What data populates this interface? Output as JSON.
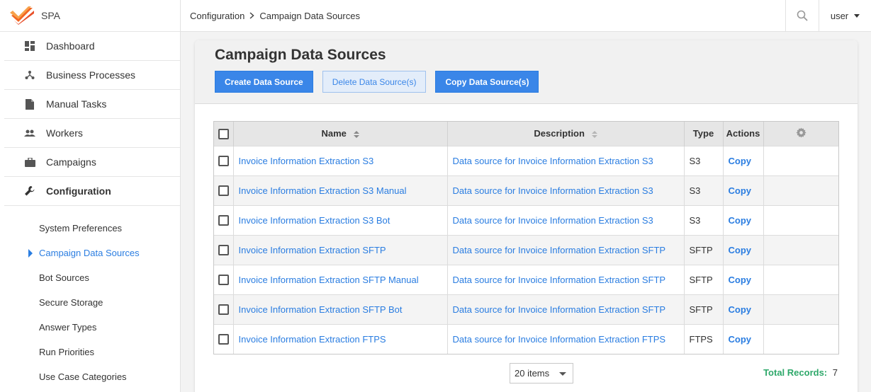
{
  "brand": {
    "name": "SPA",
    "accent": "#f26522"
  },
  "nav": {
    "items": [
      {
        "label": "Dashboard",
        "icon": "dashboard-icon"
      },
      {
        "label": "Business Processes",
        "icon": "process-icon"
      },
      {
        "label": "Manual Tasks",
        "icon": "document-icon"
      },
      {
        "label": "Workers",
        "icon": "workers-icon"
      },
      {
        "label": "Campaigns",
        "icon": "briefcase-icon"
      },
      {
        "label": "Configuration",
        "icon": "wrench-icon"
      }
    ],
    "sub_items": [
      "System Preferences",
      "Campaign Data Sources",
      "Bot Sources",
      "Secure Storage",
      "Answer Types",
      "Run Priorities",
      "Use Case Categories"
    ]
  },
  "topbar": {
    "breadcrumb": [
      "Configuration",
      "Campaign Data Sources"
    ],
    "user": "user"
  },
  "page": {
    "title": "Campaign Data Sources",
    "buttons": {
      "create": "Create Data Source",
      "delete": "Delete Data Source(s)",
      "copy": "Copy Data Source(s)"
    }
  },
  "table": {
    "columns": [
      "Name",
      "Description",
      "Type",
      "Actions"
    ],
    "rows": [
      {
        "name": "Invoice Information Extraction S3",
        "description": "Data source for Invoice Information Extraction S3",
        "type": "S3",
        "action": "Copy"
      },
      {
        "name": "Invoice Information Extraction S3 Manual",
        "description": "Data source for Invoice Information Extraction S3",
        "type": "S3",
        "action": "Copy"
      },
      {
        "name": "Invoice Information Extraction S3 Bot",
        "description": "Data source for Invoice Information Extraction S3",
        "type": "S3",
        "action": "Copy"
      },
      {
        "name": "Invoice Information Extraction SFTP",
        "description": "Data source for Invoice Information Extraction SFTP",
        "type": "SFTP",
        "action": "Copy"
      },
      {
        "name": "Invoice Information Extraction SFTP Manual",
        "description": "Data source for Invoice Information Extraction SFTP",
        "type": "SFTP",
        "action": "Copy"
      },
      {
        "name": "Invoice Information Extraction SFTP Bot",
        "description": "Data source for Invoice Information Extraction SFTP",
        "type": "SFTP",
        "action": "Copy"
      },
      {
        "name": "Invoice Information Extraction FTPS",
        "description": "Data source for Invoice Information Extraction FTPS",
        "type": "FTPS",
        "action": "Copy"
      }
    ]
  },
  "footer": {
    "page_size": "20 items",
    "total_label": "Total Records:",
    "total_value": "7"
  },
  "colors": {
    "primary": "#3a86e8",
    "link": "#2a7de1",
    "total": "#2ea86a"
  }
}
